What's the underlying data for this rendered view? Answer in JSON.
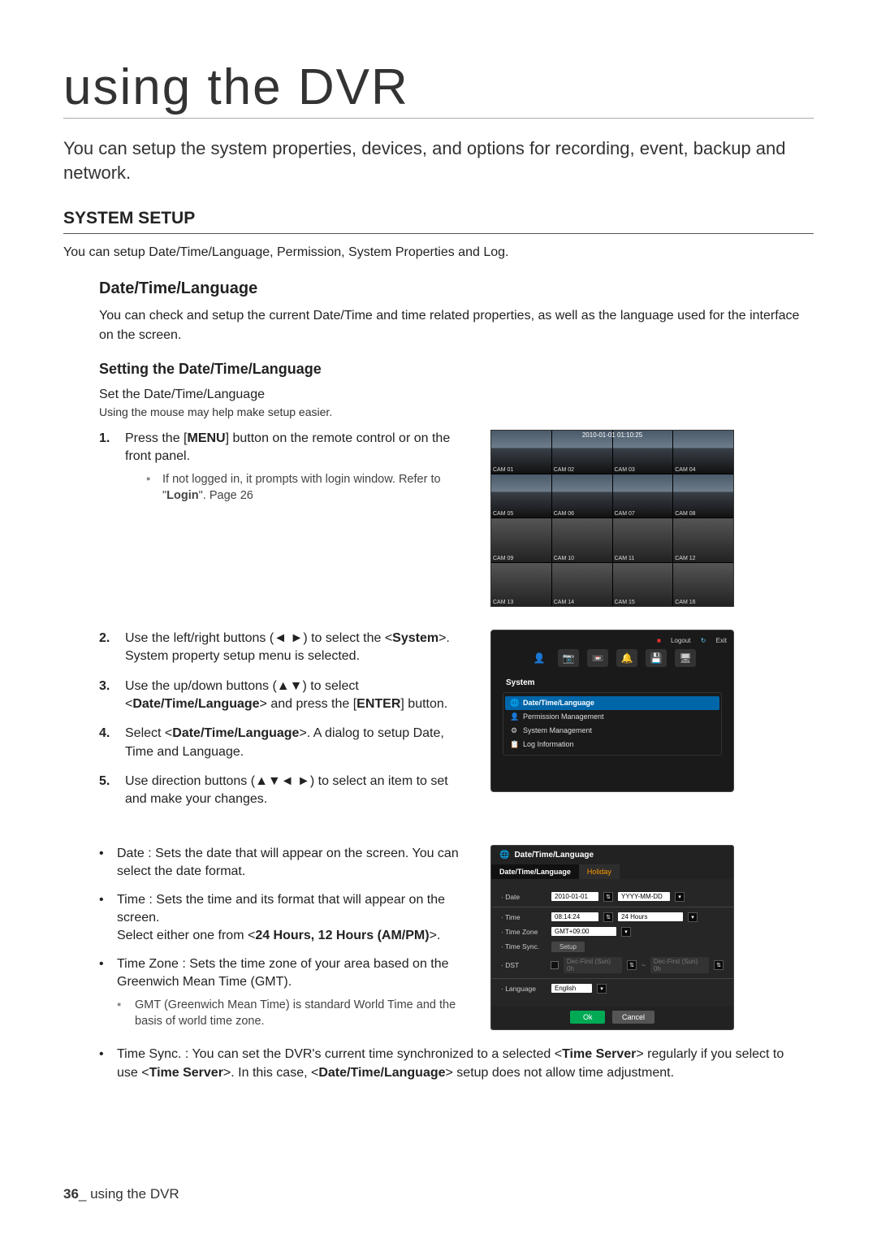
{
  "chapter_title": "using the DVR",
  "intro": "You can setup the system properties, devices, and options for recording, event, backup and network.",
  "system_setup": {
    "header": "SYSTEM SETUP",
    "desc": "You can setup Date/Time/Language, Permission, System Properties and Log."
  },
  "dtl": {
    "header": "Date/Time/Language",
    "desc": "You can check and setup the current Date/Time and time related properties, as well as the language used for the interface on the screen."
  },
  "setting": {
    "header": "Setting the Date/Time/Language",
    "line1": "Set the Date/Time/Language",
    "line2": "Using the mouse may help make setup easier."
  },
  "steps": {
    "s1_a": "Press the [",
    "s1_b": "MENU",
    "s1_c": "] button on the remote control or on the front panel.",
    "s1_sub_a": "If not logged in, it prompts with login window. Refer to \"",
    "s1_sub_b": "Login",
    "s1_sub_c": "\". Page 26",
    "s2_a": "Use the left/right buttons (◄ ►) to select the <",
    "s2_b": "System",
    "s2_c": ">. System property setup menu is selected.",
    "s3_a": "Use the up/down buttons (▲▼) to select <",
    "s3_b": "Date/Time/Language",
    "s3_c": "> and press the [",
    "s3_d": "ENTER",
    "s3_e": "] button.",
    "s4_a": "Select <",
    "s4_b": "Date/Time/Language",
    "s4_c": ">. A dialog to setup Date, Time and Language.",
    "s5": "Use direction buttons (▲▼◄ ►) to select an item to set and make your changes."
  },
  "bullets": {
    "date": "Date : Sets the date that will appear on the screen. You can select the date format.",
    "time_a": "Time : Sets the time and its format that will appear on the screen.",
    "time_b_pre": "Select either one from <",
    "time_b_bold": "24 Hours, 12 Hours (AM/PM)",
    "time_b_post": ">.",
    "tz": "Time Zone : Sets the time zone of your area based on the Greenwich Mean Time (GMT).",
    "tz_sub": "GMT (Greenwich Mean Time) is standard World Time and the basis of world time zone.",
    "sync_a": "Time Sync. : You can set the DVR's current time synchronized to a selected <",
    "sync_b": "Time Server",
    "sync_c": "> regularly if you select to use <",
    "sync_d": "Time Server",
    "sync_e": ">. In this case, <",
    "sync_f": "Date/Time/Language",
    "sync_g": "> setup does not allow time adjustment."
  },
  "cam": {
    "timestamp": "2010-01-01 01:10:25",
    "labels": [
      "CAM 01",
      "CAM 02",
      "CAM 03",
      "CAM 04",
      "CAM 05",
      "CAM 06",
      "CAM 07",
      "CAM 08",
      "CAM 09",
      "CAM 10",
      "CAM 11",
      "CAM 12",
      "CAM 13",
      "CAM 14",
      "CAM 15",
      "CAM 16"
    ]
  },
  "sysmenu": {
    "logout": "Logout",
    "exit": "Exit",
    "tab": "System",
    "rows": [
      "Date/Time/Language",
      "Permission Management",
      "System Management",
      "Log Information"
    ]
  },
  "dialog": {
    "title": "Date/Time/Language",
    "tab1": "Date/Time/Language",
    "tab2": "Holiday",
    "date_label": "· Date",
    "date_val": "2010-01-01",
    "date_fmt": "YYYY-MM-DD",
    "time_label": "· Time",
    "time_val": "08:14:24",
    "time_fmt": "24 Hours",
    "tz_label": "· Time Zone",
    "tz_val": "GMT+09:00",
    "sync_label": "· Time Sync.",
    "sync_btn": "Setup",
    "dst_label": "· DST",
    "dst_a": "Dec-First (Sun) 0h",
    "dst_b": "Dec-First (Sun) 0h",
    "lang_label": "· Language",
    "lang_val": "English",
    "ok": "Ok",
    "cancel": "Cancel"
  },
  "footer": {
    "page": "36",
    "text": "_ using the DVR"
  }
}
